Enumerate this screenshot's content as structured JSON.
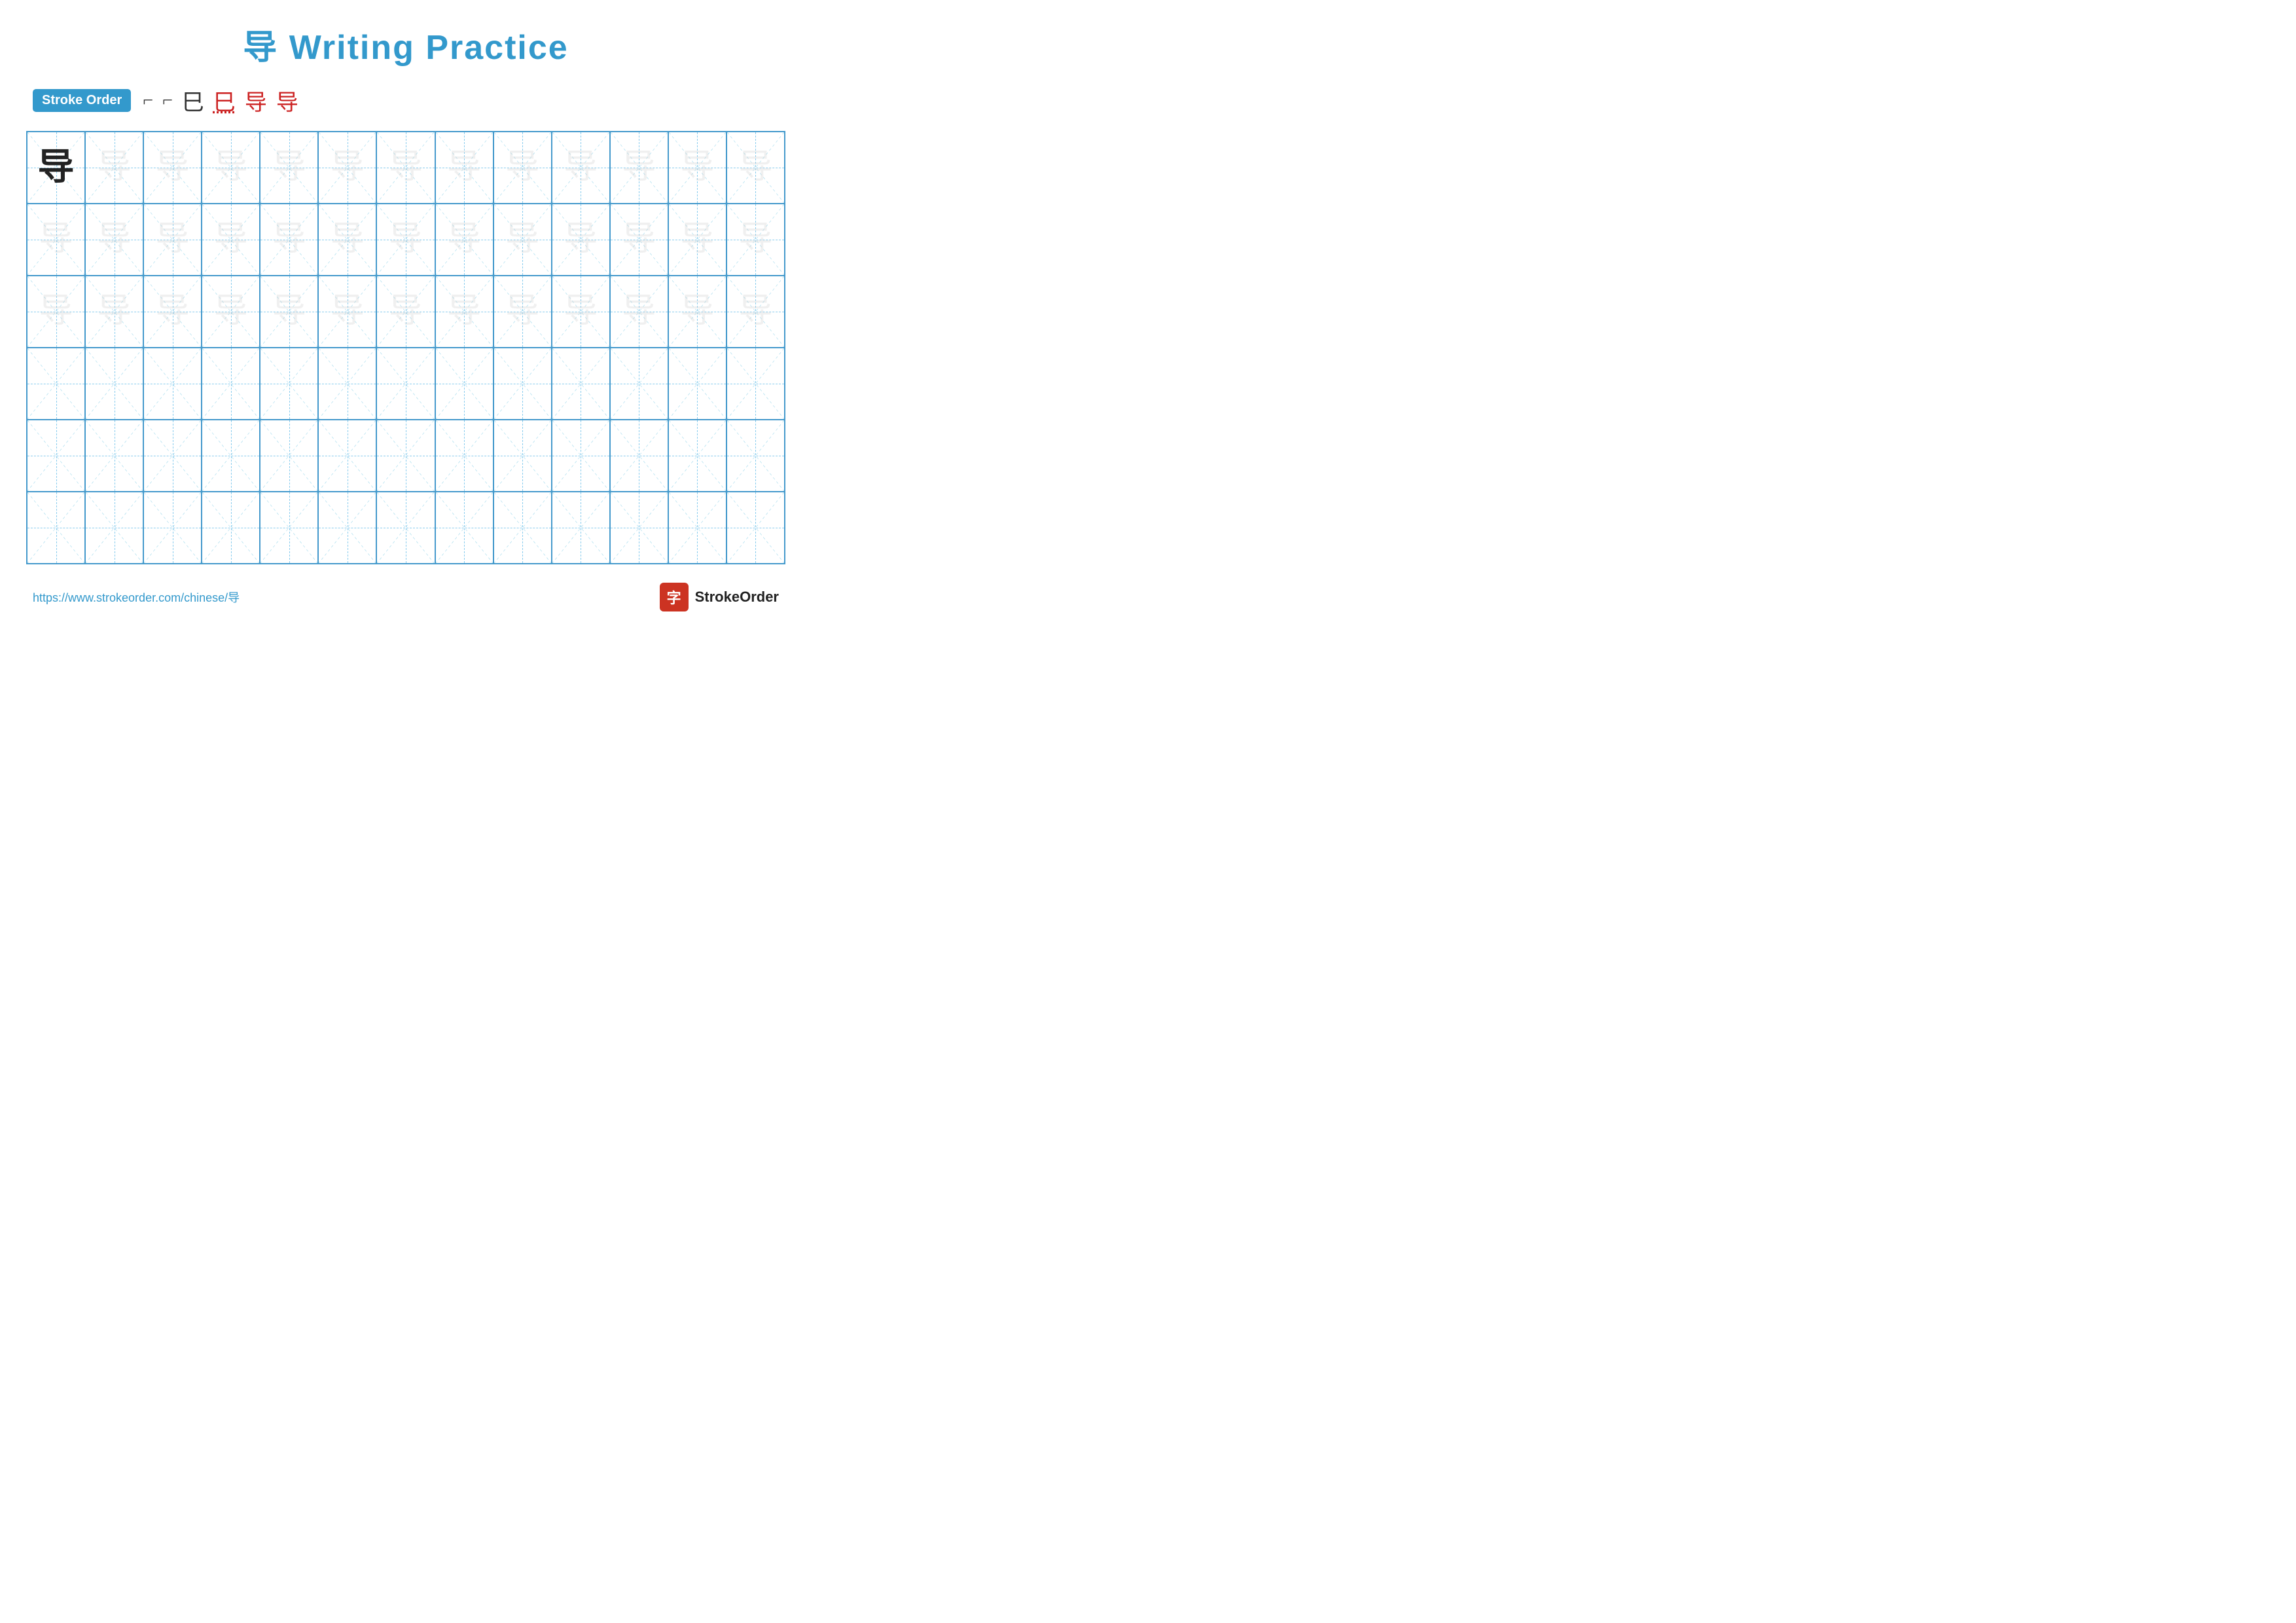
{
  "title": {
    "char": "导",
    "rest": " Writing Practice",
    "full": "导 Writing Practice"
  },
  "stroke_order": {
    "badge_label": "Stroke Order",
    "strokes": [
      "⌐",
      "⌐",
      "巳",
      "巳",
      "导",
      "导"
    ]
  },
  "grid": {
    "rows": 6,
    "cols": 13,
    "char": "导",
    "solid_count": 1,
    "guide_rows": 3
  },
  "footer": {
    "url": "https://www.strokeorder.com/chinese/导",
    "logo_char": "字",
    "logo_text": "StrokeOrder"
  }
}
